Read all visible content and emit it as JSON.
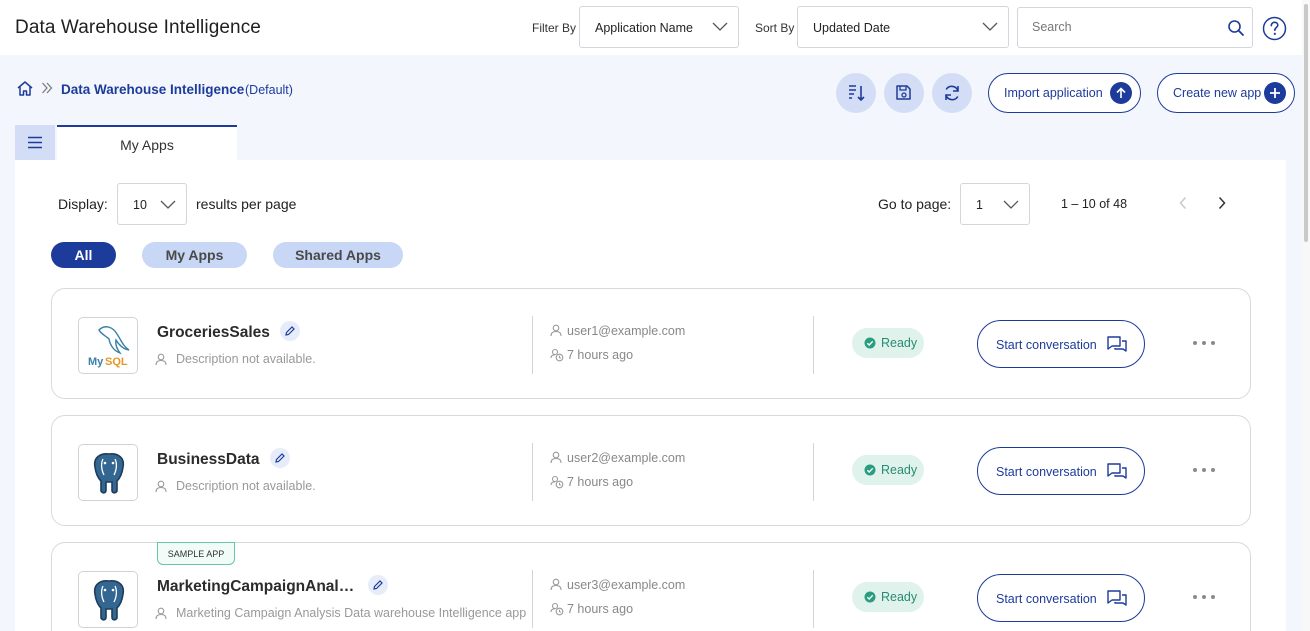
{
  "header": {
    "title": "Data Warehouse Intelligence",
    "filter_label": "Filter By",
    "filter_value": "Application Name",
    "sort_label": "Sort By",
    "sort_value": "Updated Date",
    "search_placeholder": "Search"
  },
  "breadcrumb": {
    "current": "Data Warehouse Intelligence",
    "suffix": "(Default)"
  },
  "actions": {
    "import_label": "Import application",
    "create_label": "Create new app"
  },
  "tabs": {
    "my_apps": "My Apps"
  },
  "pagination": {
    "display_label": "Display:",
    "per_page_value": "10",
    "per_page_suffix": "results per page",
    "goto_label": "Go to page:",
    "page_value": "1",
    "range_text": "1 – 10 of 48"
  },
  "filters": {
    "all": "All",
    "my_apps": "My Apps",
    "shared_apps": "Shared Apps"
  },
  "apps": [
    {
      "name": "GroceriesSales",
      "description": "Description not available.",
      "owner": "user1@example.com",
      "updated": "7 hours ago",
      "status": "Ready",
      "action": "Start conversation",
      "logo": "mysql-logo",
      "logo_text": "MySQL",
      "sample_tag": ""
    },
    {
      "name": "BusinessData",
      "description": "Description not available.",
      "owner": "user2@example.com",
      "updated": "7 hours ago",
      "status": "Ready",
      "action": "Start conversation",
      "logo": "postgresql-logo",
      "sample_tag": ""
    },
    {
      "name": "MarketingCampaignAnaly…",
      "description": "Marketing Campaign Analysis Data warehouse Intelligence app",
      "owner": "user3@example.com",
      "updated": "7 hours ago",
      "status": "Ready",
      "action": "Start conversation",
      "logo": "postgresql-logo",
      "sample_tag": "SAMPLE APP"
    }
  ],
  "colors": {
    "brand": "#1d3b9b",
    "background": "#f3f6fd",
    "ready_bg": "#dff3ec",
    "ready_text": "#2a8a73",
    "chip_inactive": "#c8d7f5"
  }
}
